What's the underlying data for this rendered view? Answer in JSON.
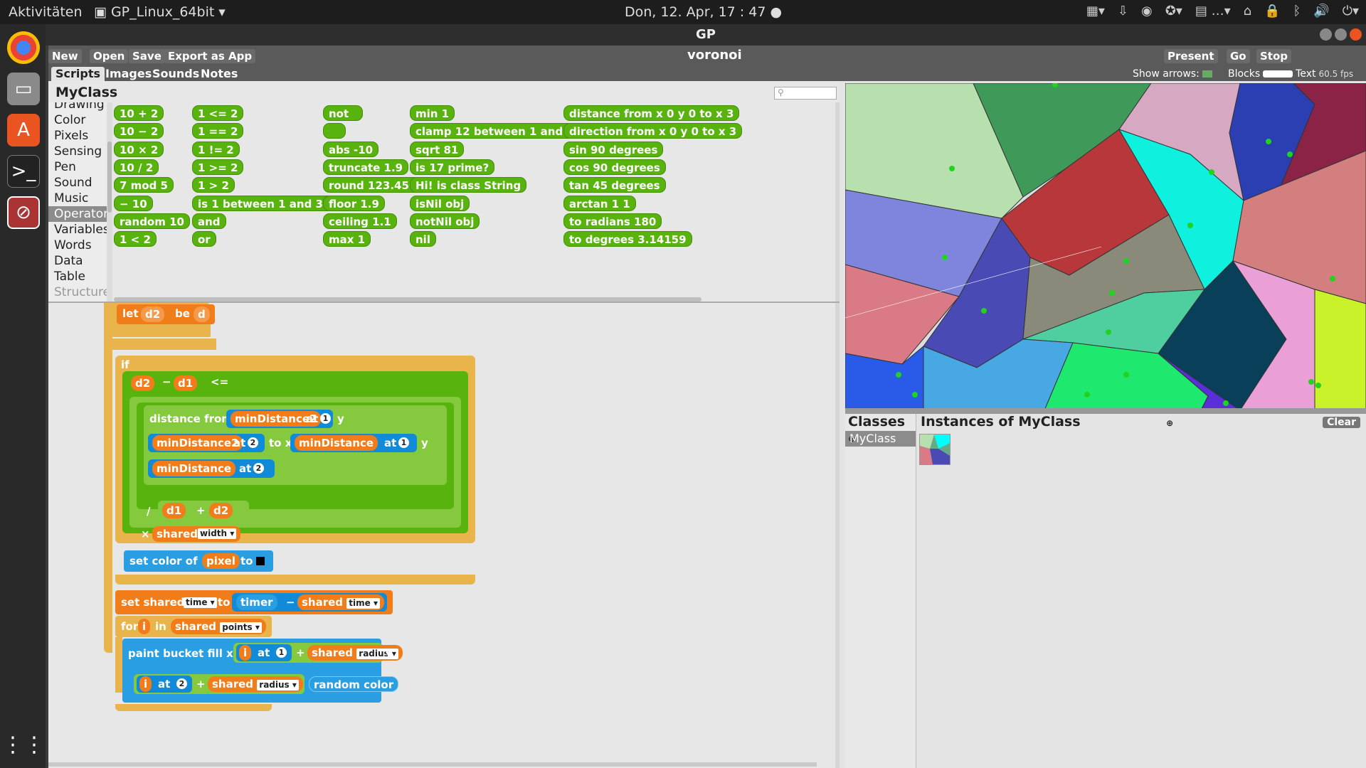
{
  "topbar": {
    "activities": "Aktivitäten",
    "app_menu": "GP_Linux_64bit",
    "clock": "Don, 12. Apr, 17 : 47"
  },
  "window": {
    "title": "GP"
  },
  "toolbar": {
    "new": "New",
    "open": "Open",
    "save": "Save",
    "export": "Export as App",
    "project_name": "voronoi",
    "present": "Present",
    "go": "Go",
    "stop": "Stop"
  },
  "tabs": [
    "Scripts",
    "Images",
    "Sounds",
    "Notes"
  ],
  "options": {
    "show_arrows": "Show arrows:",
    "blocks": "Blocks",
    "text": "Text",
    "fps": "60.5 fps"
  },
  "palette": {
    "class_name": "MyClass",
    "categories": [
      "Drawing",
      "Color",
      "Pixels",
      "Sensing",
      "Pen",
      "Sound",
      "Music",
      "Operators",
      "Variables",
      "Words",
      "Data",
      "Table",
      "Structure"
    ],
    "blocks": {
      "c1": [
        "10 + 2",
        "10 − 2",
        "10 × 2",
        "10 / 2",
        "7 mod 5",
        "− 10",
        "random 10",
        "1 < 2"
      ],
      "c2": [
        "1 <= 2",
        "1 == 2",
        "1 != 2",
        "1 >= 2",
        "1 > 2",
        "is 1 between 1 and 3 ?",
        "and",
        "or"
      ],
      "c3": [
        "not",
        "",
        "abs -10",
        "truncate 1.9",
        "round 123.456",
        "floor 1.9",
        "ceiling 1.1",
        "max 1"
      ],
      "c4": [
        "min 1",
        "clamp 12 between 1 and 10",
        "sqrt 81",
        "is 17 prime?",
        "Hi! is class String",
        "isNil obj",
        "notNil obj",
        "nil"
      ],
      "c5": [
        "distance from x 0 y 0 to x 3",
        "direction from x 0 y 0 to x 3",
        "sin 90 degrees",
        "cos 90 degrees",
        "tan 45 degrees",
        "arctan 1 1",
        "to radians 180",
        "to degrees 3.14159"
      ]
    }
  },
  "script": {
    "let": "let",
    "d2": "d2",
    "be": "be",
    "d": "d",
    "if": "if",
    "d1": "d1",
    "minus": "−",
    "le": "<=",
    "distance_from_x": "distance from x",
    "minDistance2": "minDistance2",
    "at": "at",
    "y": "y",
    "to_x": "to x",
    "minDistance": "minDistance",
    "n1": "1",
    "n2": "2",
    "div": "/",
    "plus": "+",
    "times": "×",
    "shared": "shared",
    "width": "width",
    "set_color_of": "set color of",
    "pixel": "pixel",
    "to": "to",
    "set_shared": "set shared",
    "time": "time",
    "timer": "timer",
    "for": "for",
    "i": "i",
    "in": "in",
    "points": "points",
    "paint_bucket_fill_x": "paint bucket fill x",
    "radius": "radius",
    "random_color": "random color"
  },
  "classes": {
    "title": "Classes",
    "items": [
      "MyClass"
    ]
  },
  "instances": {
    "title": "Instances of MyClass",
    "clear": "Clear"
  }
}
